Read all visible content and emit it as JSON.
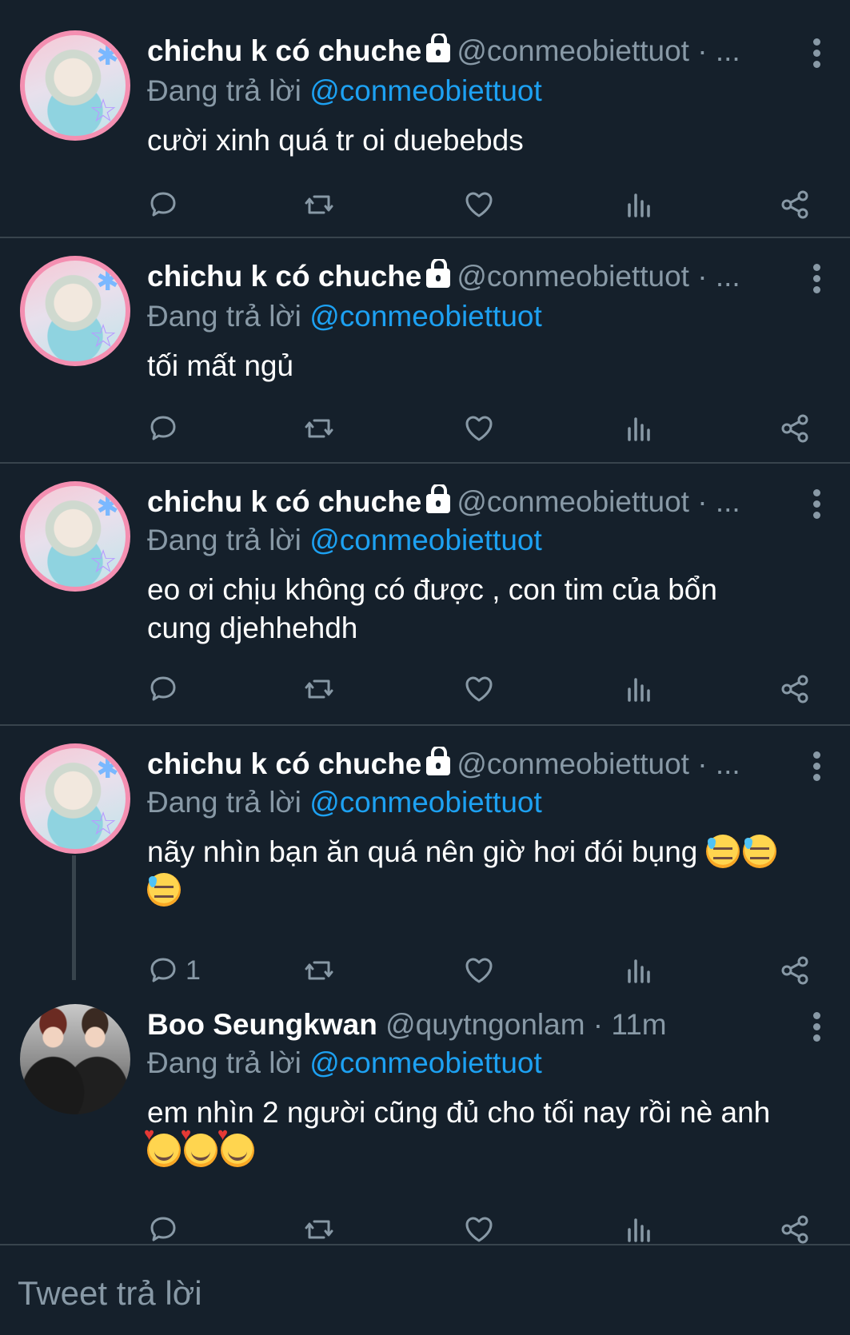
{
  "tweets": [
    {
      "name": "chichu k có chuche",
      "handle": "@conmeobiettuot · ...",
      "replying_prefix": "Đang trả lời",
      "replying_to": "@conmeobiettuot",
      "text": "cười xinh quá tr oi duebebds",
      "reply_count": ""
    },
    {
      "name": "chichu k có chuche",
      "handle": "@conmeobiettuot · ...",
      "replying_prefix": "Đang trả lời",
      "replying_to": "@conmeobiettuot",
      "text": "tối mất ngủ",
      "reply_count": ""
    },
    {
      "name": "chichu k có chuche",
      "handle": "@conmeobiettuot · ...",
      "replying_prefix": "Đang trả lời",
      "replying_to": "@conmeobiettuot",
      "text_line1": "eo ơi chịu không có được , con tim của bổn",
      "text_line2": "cung djehhehdh",
      "reply_count": ""
    },
    {
      "name": "chichu k có chuche",
      "handle": "@conmeobiettuot · ...",
      "replying_prefix": "Đang trả lời",
      "replying_to": "@conmeobiettuot",
      "text": "nãy nhìn bạn ăn quá nên giờ hơi đói bụng",
      "emoji": "downcast-face-with-sweat",
      "reply_count": "1"
    },
    {
      "name": "Boo Seungkwan",
      "handle": "@quytngonlam · 11m",
      "replying_prefix": "Đang trả lời",
      "replying_to": "@conmeobiettuot",
      "text": "em nhìn 2 người cũng đủ cho tối nay rồi nè anh",
      "emoji": "smiling-face-with-hearts",
      "reply_count": ""
    }
  ],
  "compose": {
    "placeholder": "Tweet trả lời"
  },
  "colors": {
    "background": "#15202b",
    "divider": "#38444d",
    "secondary_text": "#8899a6",
    "mention": "#1da1f2"
  },
  "icons": [
    "reply-icon",
    "retweet-icon",
    "like-icon",
    "analytics-icon",
    "share-icon",
    "more-options-icon",
    "lock-icon"
  ]
}
